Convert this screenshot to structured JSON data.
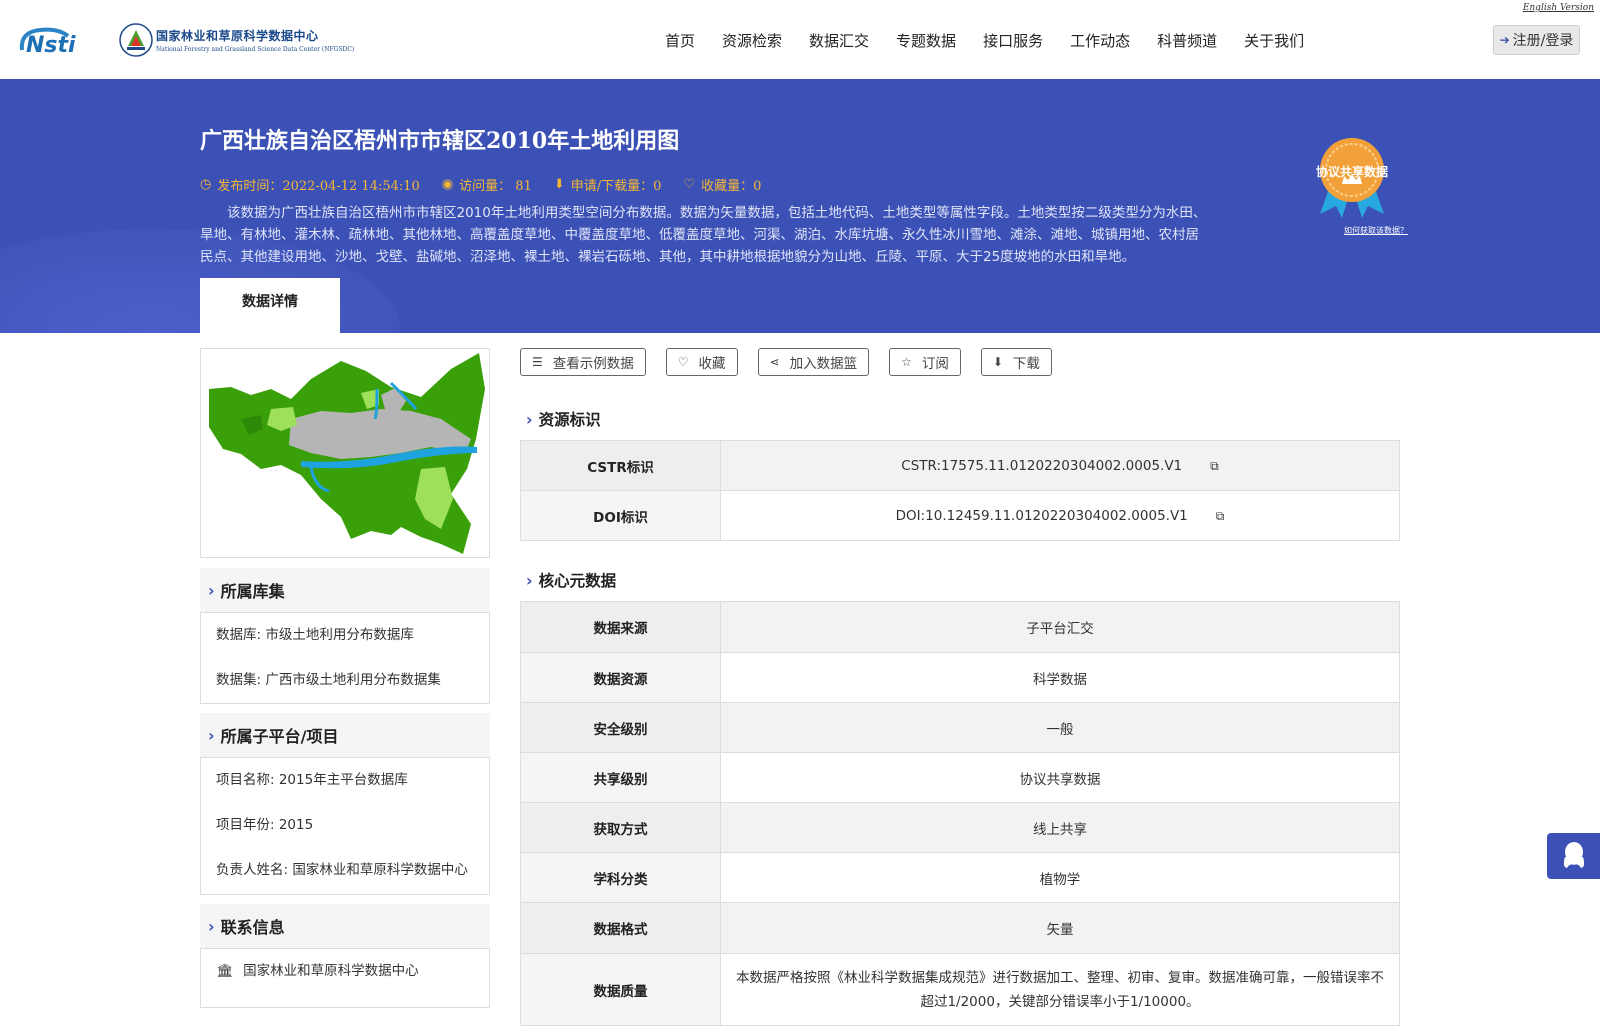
{
  "header": {
    "english_link": "English Version",
    "logo_center_cn": "国家林业和草原科学数据中心",
    "logo_center_en": "National Forestry and Grassland Science Data Center (NFGSDC)",
    "nav": [
      "首页",
      "资源检索",
      "数据汇交",
      "专题数据",
      "接口服务",
      "工作动态",
      "科普频道",
      "关于我们"
    ],
    "login_label": "注册/登录"
  },
  "banner": {
    "title": "广西壮族自治区梧州市市辖区2010年土地利用图",
    "publish_time": "发布时间：2022-04-12 14:54:10",
    "visits": "访问量： 81",
    "downloads": "申请/下载量：0",
    "favorites": "收藏量：0",
    "description": "该数据为广西壮族自治区梧州市市辖区2010年土地利用类型空间分布数据。数据为矢量数据，包括土地代码、土地类型等属性字段。土地类型按二级类型分为水田、旱地、有林地、灌木林、疏林地、其他林地、高覆盖度草地、中覆盖度草地、低覆盖度草地、河渠、湖泊、水库坑塘、永久性冰川雪地、滩涂、滩地、城镇用地、农村居民点、其他建设用地、沙地、戈壁、盐碱地、沼泽地、裸土地、裸岩石砾地、其他，其中耕地根据地貌分为山地、丘陵、平原、大于25度坡地的水田和旱地。",
    "badge_label": "协议共享数据",
    "how_link": "如何获取该数据？",
    "tab_label": "数据详情"
  },
  "sidebar": {
    "library_title": "所属库集",
    "library_rows": [
      "数据库: 市级土地利用分布数据库",
      "数据集: 广西市级土地利用分布数据集"
    ],
    "project_title": "所属子平台/项目",
    "project_rows": [
      "项目名称: 2015年主平台数据库",
      "项目年份: 2015",
      "负责人姓名: 国家林业和草原科学数据中心"
    ],
    "contact_title": "联系信息",
    "contact_org": "国家林业和草原科学数据中心"
  },
  "actions": {
    "sample": "查看示例数据",
    "favorite": "收藏",
    "basket": "加入数据篮",
    "subscribe": "订阅",
    "download": "下载"
  },
  "identifiers": {
    "title": "资源标识",
    "rows": [
      {
        "key": "CSTR标识",
        "value": "CSTR:17575.11.0120220304002.0005.V1"
      },
      {
        "key": "DOI标识",
        "value": "DOI:10.12459.11.0120220304002.0005.V1"
      }
    ]
  },
  "core_meta": {
    "title": "核心元数据",
    "rows": [
      {
        "key": "数据来源",
        "value": "子平台汇交"
      },
      {
        "key": "数据资源",
        "value": "科学数据"
      },
      {
        "key": "安全级别",
        "value": "一般"
      },
      {
        "key": "共享级别",
        "value": "协议共享数据"
      },
      {
        "key": "获取方式",
        "value": "线上共享"
      },
      {
        "key": "学科分类",
        "value": "植物学"
      },
      {
        "key": "数据格式",
        "value": "矢量"
      },
      {
        "key": "数据质量",
        "value": "本数据严格按照《林业科学数据集成规范》进行数据加工、整理、初审、复审。数据准确可靠，一般错误率不超过1/2000，关键部分错误率小于1/10000。"
      }
    ]
  },
  "colors": {
    "banner_bg": "#3c51b6",
    "meta_accent": "#f7b733",
    "map_forest": "#3aa00a",
    "map_urban": "#b5b5b5",
    "map_water": "#1fa3e0"
  }
}
